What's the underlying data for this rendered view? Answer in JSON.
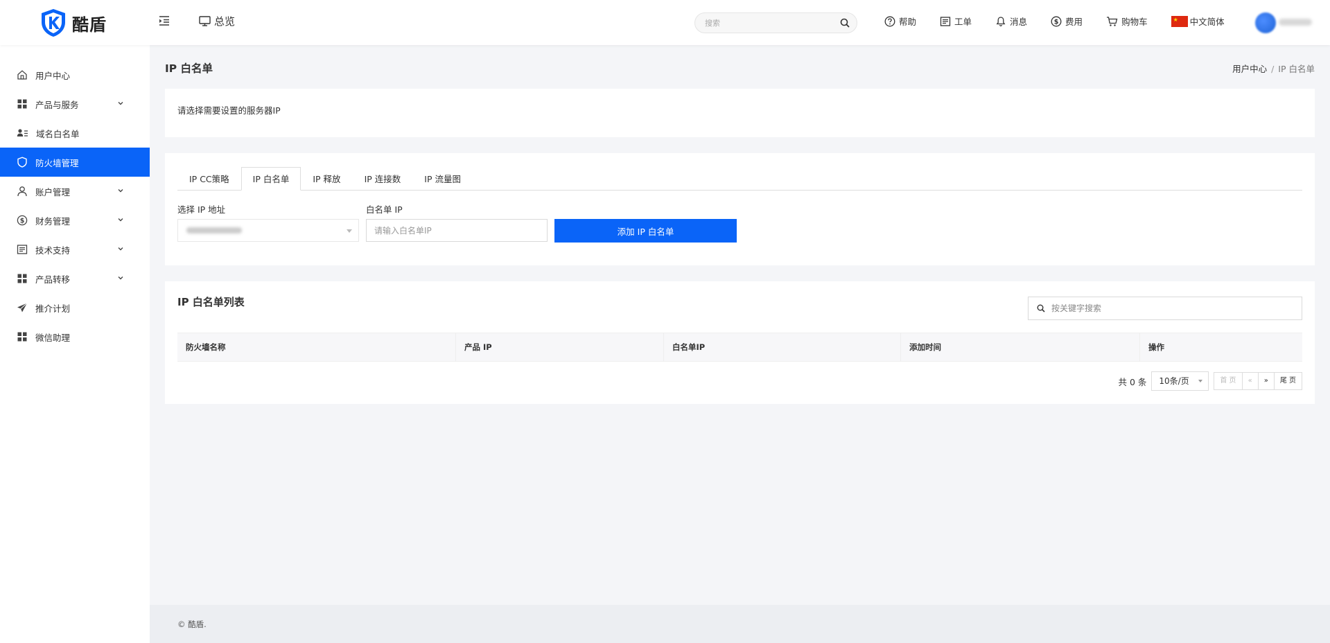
{
  "brand": {
    "name": "酷盾",
    "accent": "#0a64f8"
  },
  "header": {
    "overview_label": "总览",
    "search_placeholder": "搜索",
    "nav": [
      {
        "label": "帮助",
        "icon": "help-icon"
      },
      {
        "label": "工单",
        "icon": "ticket-icon"
      },
      {
        "label": "消息",
        "icon": "bell-icon"
      },
      {
        "label": "费用",
        "icon": "dollar-icon"
      },
      {
        "label": "购物车",
        "icon": "cart-icon"
      },
      {
        "label": "中文简体",
        "icon": "china-flag-icon"
      }
    ]
  },
  "sidebar": {
    "items": [
      {
        "label": "用户中心",
        "icon": "home-icon"
      },
      {
        "label": "产品与服务",
        "icon": "grid-icon",
        "expandable": true
      },
      {
        "label": "域名白名单",
        "icon": "user-list-icon"
      },
      {
        "label": "防火墙管理",
        "icon": "shield-icon",
        "active": true
      },
      {
        "label": "账户管理",
        "icon": "user-icon",
        "expandable": true
      },
      {
        "label": "财务管理",
        "icon": "dollar-icon",
        "expandable": true
      },
      {
        "label": "技术支持",
        "icon": "document-icon",
        "expandable": true
      },
      {
        "label": "产品转移",
        "icon": "grid-icon",
        "expandable": true
      },
      {
        "label": "推介计划",
        "icon": "paper-plane-icon"
      },
      {
        "label": "微信助理",
        "icon": "grid-icon"
      }
    ]
  },
  "page": {
    "title": "IP 白名单",
    "breadcrumb": {
      "root": "用户中心",
      "separator": "/",
      "current": "IP 白名单"
    }
  },
  "hint_card": {
    "text": "请选择需要设置的服务器IP"
  },
  "form_card": {
    "tabs": [
      "IP CC策略",
      "IP 白名单",
      "IP 释放",
      "IP 连接数",
      "IP 流量图"
    ],
    "active_tab": 1,
    "select_label": "选择 IP 地址",
    "whitelist_label": "白名单 IP",
    "whitelist_placeholder": "请输入白名单IP",
    "add_button": "添加 IP 白名单"
  },
  "list_card": {
    "title": "IP 白名单列表",
    "search_placeholder": "按关键字搜索",
    "columns": [
      "防火墙名称",
      "产品 IP",
      "白名单IP",
      "添加时间",
      "操作"
    ],
    "rows": [],
    "pager": {
      "total": "共 0 条",
      "per_page": "10条/页",
      "first": "首 页",
      "prev": "«",
      "next": "»",
      "last": "尾 页"
    }
  },
  "footer": {
    "text": "© 酷盾."
  }
}
